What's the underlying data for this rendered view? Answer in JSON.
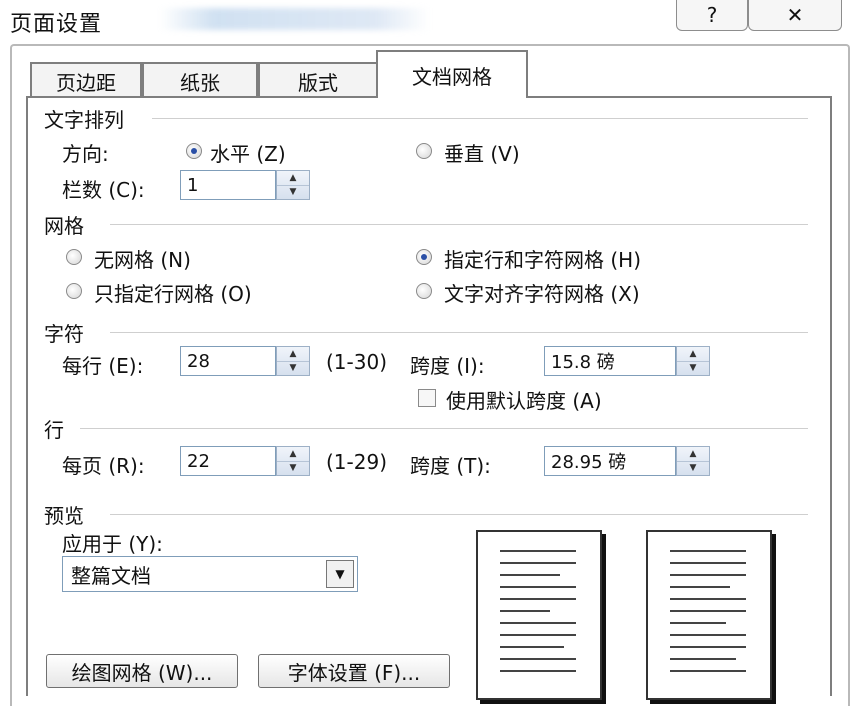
{
  "window": {
    "title": "页面设置",
    "help_icon_glyph": "?",
    "close_icon_glyph": "✕"
  },
  "tabs": [
    {
      "label": "页边距",
      "active": false
    },
    {
      "label": "纸张",
      "active": false
    },
    {
      "label": "版式",
      "active": false
    },
    {
      "label": "文档网格",
      "active": true
    }
  ],
  "text_layout": {
    "title": "文字排列",
    "direction_label": "方向:",
    "horizontal_label": "水平 (Z)",
    "vertical_label": "垂直 (V)",
    "columns_label": "栏数 (C):",
    "columns_value": "1"
  },
  "grid": {
    "title": "网格",
    "options": [
      {
        "label": "无网格 (N)",
        "selected": false
      },
      {
        "label": "指定行和字符网格 (H)",
        "selected": true
      },
      {
        "label": "只指定行网格 (O)",
        "selected": false
      },
      {
        "label": "文字对齐字符网格 (X)",
        "selected": false
      }
    ]
  },
  "characters": {
    "title": "字符",
    "per_line_label": "每行 (E):",
    "per_line_value": "28",
    "range": "(1-30)",
    "pitch_label": "跨度 (I):",
    "pitch_value": "15.8 磅",
    "default_pitch_label": "使用默认跨度 (A)",
    "default_pitch_checked": false
  },
  "lines": {
    "title": "行",
    "per_page_label": "每页 (R):",
    "per_page_value": "22",
    "range": "(1-29)",
    "pitch_label": "跨度 (T):",
    "pitch_value": "28.95 磅"
  },
  "preview": {
    "title": "预览",
    "apply_to_label": "应用于 (Y):",
    "apply_to_value": "整篇文档"
  },
  "buttons": {
    "drawing_grid": "绘图网格 (W)...",
    "font_settings": "字体设置 (F)..."
  },
  "spin_glyphs": {
    "up": "▲",
    "down": "▼"
  },
  "combo_glyph": "▼",
  "colors": {
    "radio_selected": "#2a4fa6",
    "input_border": "#7f9db9",
    "divider": "#cfcfcf"
  }
}
